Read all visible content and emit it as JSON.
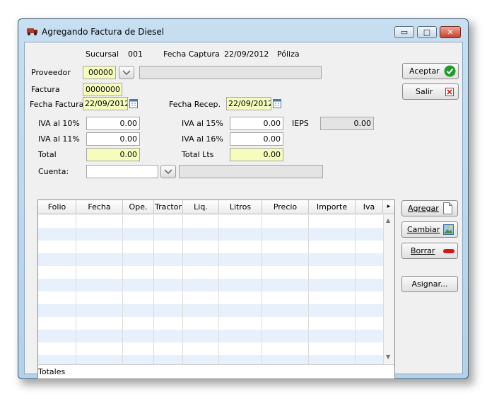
{
  "window": {
    "title": "Agregando Factura de Diesel",
    "min_glyph": "▭",
    "max_glyph": "□",
    "close_glyph": "✕"
  },
  "header": {
    "sucursal_label": "Sucursal",
    "sucursal_value": "001",
    "fecha_captura_label": "Fecha Captura",
    "fecha_captura_value": "22/09/2012",
    "poliza_label": "Póliza"
  },
  "form": {
    "proveedor_label": "Proveedor",
    "proveedor_value": "00000",
    "proveedor_name": "",
    "factura_label": "Factura",
    "factura_value": "0000000",
    "fecha_factura_label": "Fecha Factura",
    "fecha_factura_value": "22/09/2012",
    "fecha_recep_label": "Fecha Recep.",
    "fecha_recep_value": "22/09/2012",
    "iva10_label": "IVA al 10%",
    "iva10_value": "0.00",
    "iva15_label": "IVA al 15%",
    "iva15_value": "0.00",
    "ieps_label": "IEPS",
    "ieps_value": "0.00",
    "iva11_label": "IVA al 11%",
    "iva11_value": "0.00",
    "iva16_label": "IVA al 16%",
    "iva16_value": "0.00",
    "total_label": "Total",
    "total_value": "0.00",
    "total_lts_label": "Total Lts",
    "total_lts_value": "0.00",
    "cuenta_label": "Cuenta:",
    "cuenta_value": "",
    "cuenta_desc": ""
  },
  "grid": {
    "columns": [
      "Folio",
      "Fecha",
      "Ope.",
      "Tractor",
      "Liq.",
      "Litros",
      "Precio",
      "Importe",
      "Iva"
    ],
    "more_arrow": "▸",
    "scroll_up": "▲",
    "scroll_down": "▼",
    "totals_label": "Totales"
  },
  "actions": {
    "aceptar": "Aceptar",
    "salir": "Salir",
    "agregar": "Agregar",
    "cambiar": "Cambiar",
    "borrar": "Borrar",
    "asignar": "Asignar..."
  },
  "colors": {
    "accent_yellow": "#f5fcbc",
    "grid_alt_row": "#e8f1fb",
    "ok_green": "#1f9b2a",
    "cancel_red": "#c62828"
  }
}
